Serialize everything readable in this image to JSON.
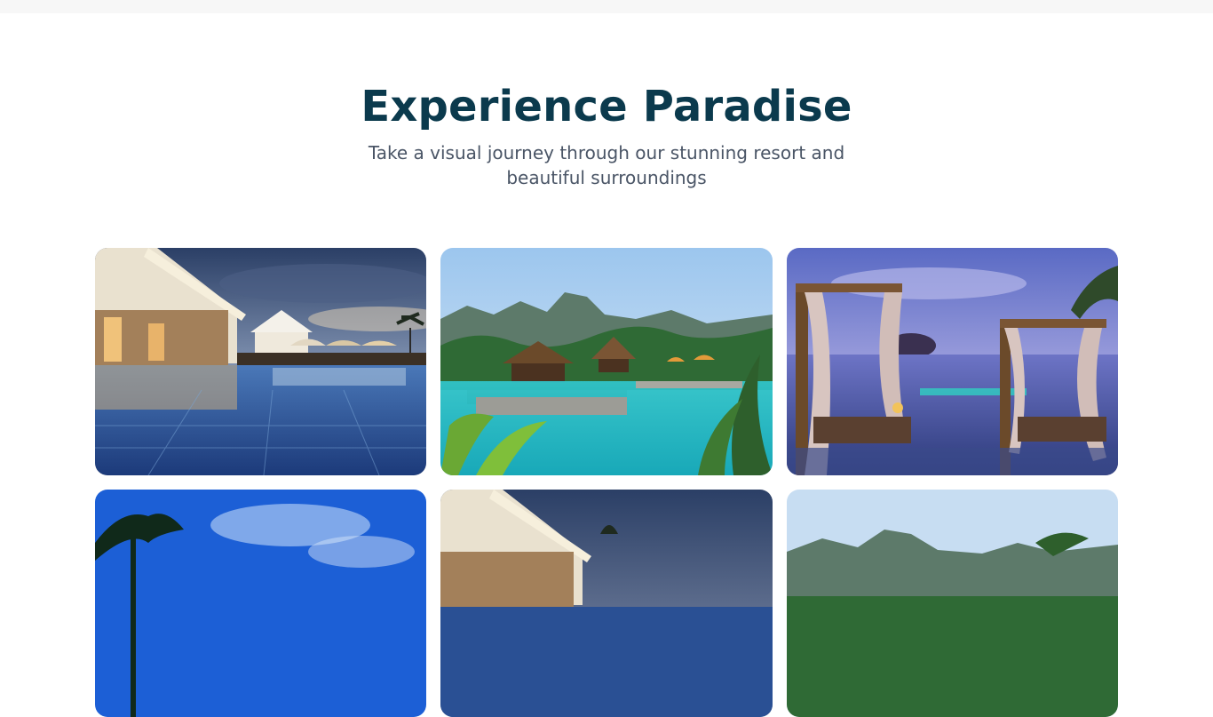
{
  "gallery_section": {
    "title": "Experience Paradise",
    "subtitle": "Take a visual journey through our stunning resort and beautiful surroundings"
  },
  "gallery": {
    "items": [
      {
        "scene": "pool-villa-night"
      },
      {
        "scene": "tropical-pool-mountains"
      },
      {
        "scene": "cabana-sunset-sea"
      },
      {
        "scene": "palm-blue-sky"
      },
      {
        "scene": "pool-villa-night"
      },
      {
        "scene": "tropical-pool-mountains"
      }
    ]
  }
}
